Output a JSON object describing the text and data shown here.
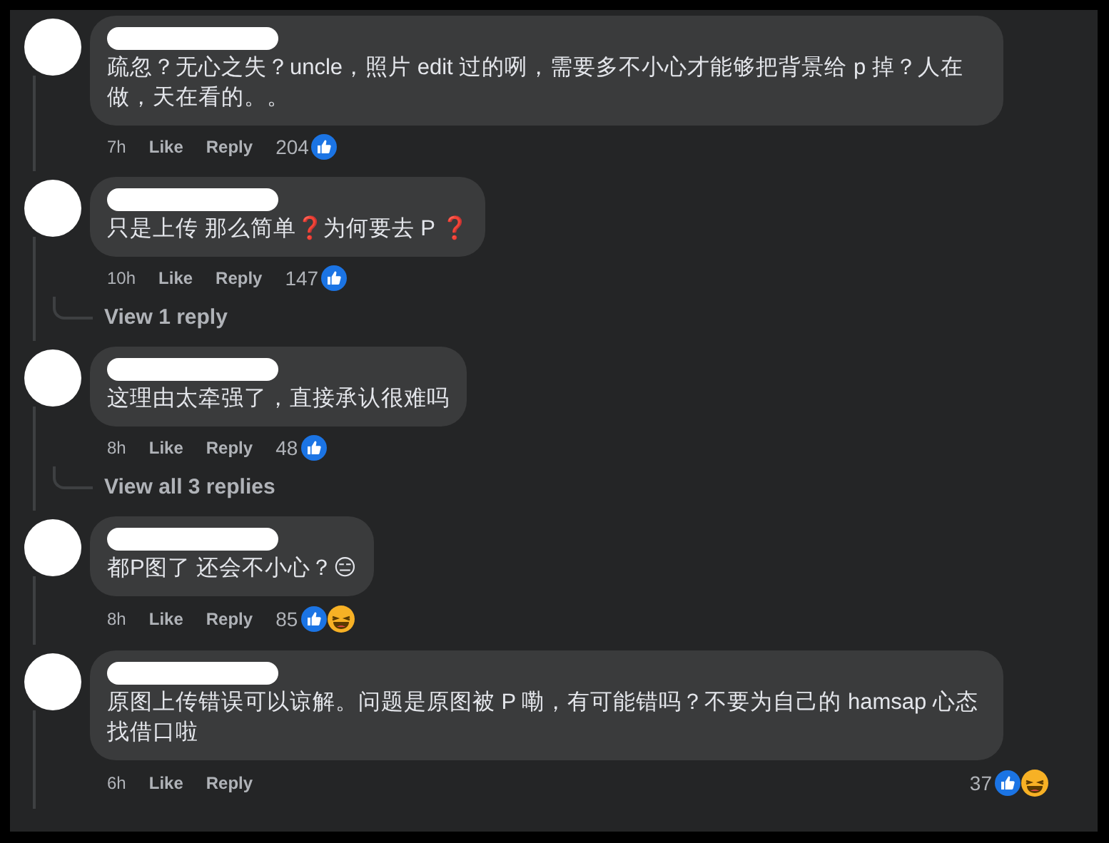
{
  "comments": [
    {
      "text": "疏忽？无心之失？uncle，照片 edit 过的咧，需要多不小心才能够把背景给 p 掉？人在做，天在看的。。",
      "time": "7h",
      "like": "Like",
      "reply": "Reply",
      "count": "204",
      "reactions": [
        {
          "kind": "like"
        }
      ],
      "reactions_at_end": false
    },
    {
      "text": "只是上传 那么简单❓为何要去 P ❓",
      "time": "10h",
      "like": "Like",
      "reply": "Reply",
      "count": "147",
      "reactions": [
        {
          "kind": "like"
        }
      ],
      "reactions_at_end": false,
      "replies_link": "View 1 reply"
    },
    {
      "text": "这理由太牵强了，直接承认很难吗",
      "time": "8h",
      "like": "Like",
      "reply": "Reply",
      "count": "48",
      "reactions": [
        {
          "kind": "like"
        }
      ],
      "reactions_at_end": false,
      "replies_link": "View all 3 replies"
    },
    {
      "text": "都P图了 还会不小心？😑",
      "time": "8h",
      "like": "Like",
      "reply": "Reply",
      "count": "85",
      "reactions": [
        {
          "kind": "like"
        },
        {
          "kind": "haha"
        }
      ],
      "reactions_at_end": false
    },
    {
      "text": "原图上传错误可以谅解。问题是原图被 P 嘞，有可能错吗？不要为自己的 hamsap 心态找借口啦",
      "time": "6h",
      "like": "Like",
      "reply": "Reply",
      "count": "37",
      "reactions": [
        {
          "kind": "like"
        },
        {
          "kind": "haha"
        }
      ],
      "reactions_at_end": true
    }
  ]
}
